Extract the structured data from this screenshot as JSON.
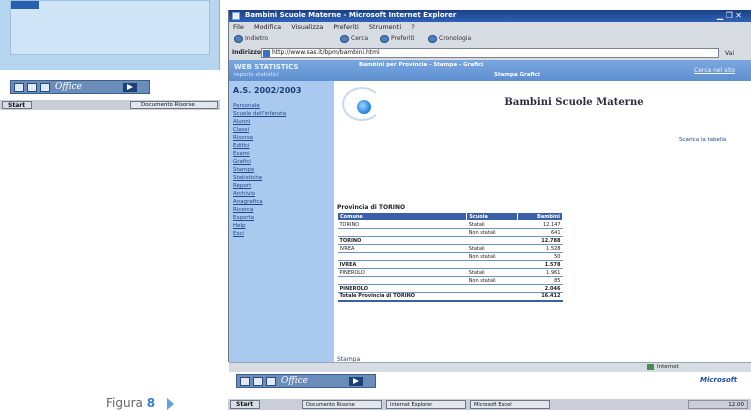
{
  "back_window": {
    "taskbar": {
      "start_label": "Start",
      "task_label": "Documento Risorse",
      "office_label": "Office"
    }
  },
  "ie": {
    "title": "Bambini Scuole Materne - Microsoft Internet Explorer",
    "menu": [
      "File",
      "Modifica",
      "Visualizza",
      "Preferiti",
      "Strumenti",
      "?"
    ],
    "toolbar": [
      "Indietro",
      "Cerca",
      "Preferiti",
      "Cronologia"
    ],
    "address_label": "Indirizzo",
    "address_value": "http://www.sas.it/bpm/bambini.html",
    "go_label": "Vai",
    "site": {
      "brand": "WEB STATISTICS",
      "brand_sub": "reports statistici",
      "links1": "Bambini per Provincia - Stampa - Grafici",
      "links2": "Stampa Grafici",
      "cerca": "Cerca nel sito"
    },
    "sidebar": {
      "year": "A.S. 2002/2003",
      "items": [
        "Personale",
        "Scuole dell'infanzia",
        "Alunni",
        "Classi",
        "Risorse",
        "Edifici",
        "Esami",
        "Grafici",
        "Stampe",
        "Statistiche",
        "Report",
        "Archivio",
        "Anagrafica",
        "Ricerca",
        "Esporta",
        "Help",
        "Esci"
      ]
    },
    "page_title": "Bambini Scuole Materne",
    "download_link": "Scarica la tabella",
    "province_label": "Provincia di TORINO",
    "table": {
      "headers": [
        "Comune",
        "Scuola",
        "Bambini"
      ],
      "rows": [
        {
          "c1": "TORINO",
          "c2": "Statali",
          "c3": "12.147",
          "kind": "row"
        },
        {
          "c1": "",
          "c2": "Non statali",
          "c3": "641",
          "kind": "row"
        },
        {
          "c1": "TORINO",
          "c2": "",
          "c3": "12.788",
          "kind": "sub"
        },
        {
          "c1": "IVREA",
          "c2": "Statali",
          "c3": "1.528",
          "kind": "row"
        },
        {
          "c1": "",
          "c2": "Non statali",
          "c3": "50",
          "kind": "row"
        },
        {
          "c1": "IVREA",
          "c2": "",
          "c3": "1.578",
          "kind": "sub"
        },
        {
          "c1": "PINEROLO",
          "c2": "Statali",
          "c3": "1.961",
          "kind": "row"
        },
        {
          "c1": "",
          "c2": "Non statali",
          "c3": "85",
          "kind": "row"
        },
        {
          "c1": "PINEROLO",
          "c2": "",
          "c3": "2.046",
          "kind": "sub"
        },
        {
          "c1": "Totale Provincia di TORINO",
          "c2": "",
          "c3": "16.412",
          "kind": "tot"
        }
      ]
    },
    "print_link": "Stampa",
    "status_zone": "Internet"
  },
  "bottom_bar": {
    "office_label": "Office",
    "ms_badge": "Microsoft",
    "taskbar": {
      "start_label": "Start",
      "task1": "Documento Risorse",
      "task2": "Internet Explorer",
      "task3": "Microsoft Excel",
      "clock": "12.00"
    }
  },
  "caption": {
    "word": "Figura",
    "number": "8"
  }
}
